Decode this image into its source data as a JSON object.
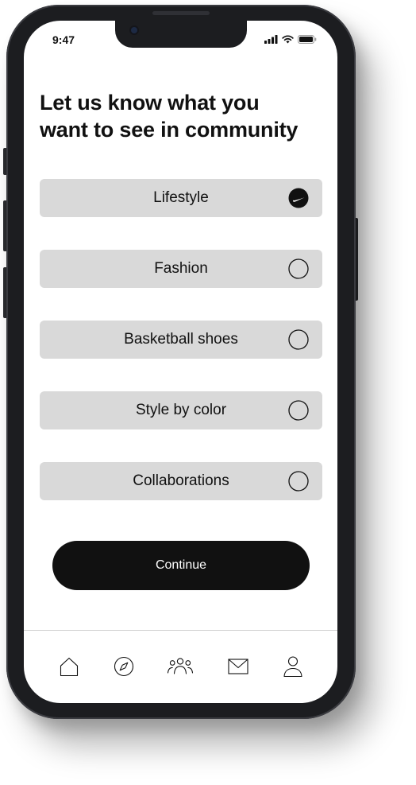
{
  "status_bar": {
    "time": "9:47",
    "icons": [
      "signal-icon",
      "wifi-icon",
      "battery-icon"
    ]
  },
  "header": {
    "title_line1": "Let us know what you",
    "title_line2": "want to see in community"
  },
  "options": [
    {
      "label": "Lifestyle",
      "selected": true
    },
    {
      "label": "Fashion",
      "selected": false
    },
    {
      "label": "Basketball shoes",
      "selected": false
    },
    {
      "label": "Style by color",
      "selected": false
    },
    {
      "label": "Collaborations",
      "selected": false
    }
  ],
  "actions": {
    "continue_label": "Continue"
  },
  "tab_bar": {
    "tabs": [
      "home-icon",
      "compass-icon",
      "community-icon",
      "mail-icon",
      "profile-icon"
    ]
  },
  "colors": {
    "option_background": "#d9d9d9",
    "primary_button": "#111111",
    "text": "#111111",
    "phone_frame": "#1c1d20"
  }
}
